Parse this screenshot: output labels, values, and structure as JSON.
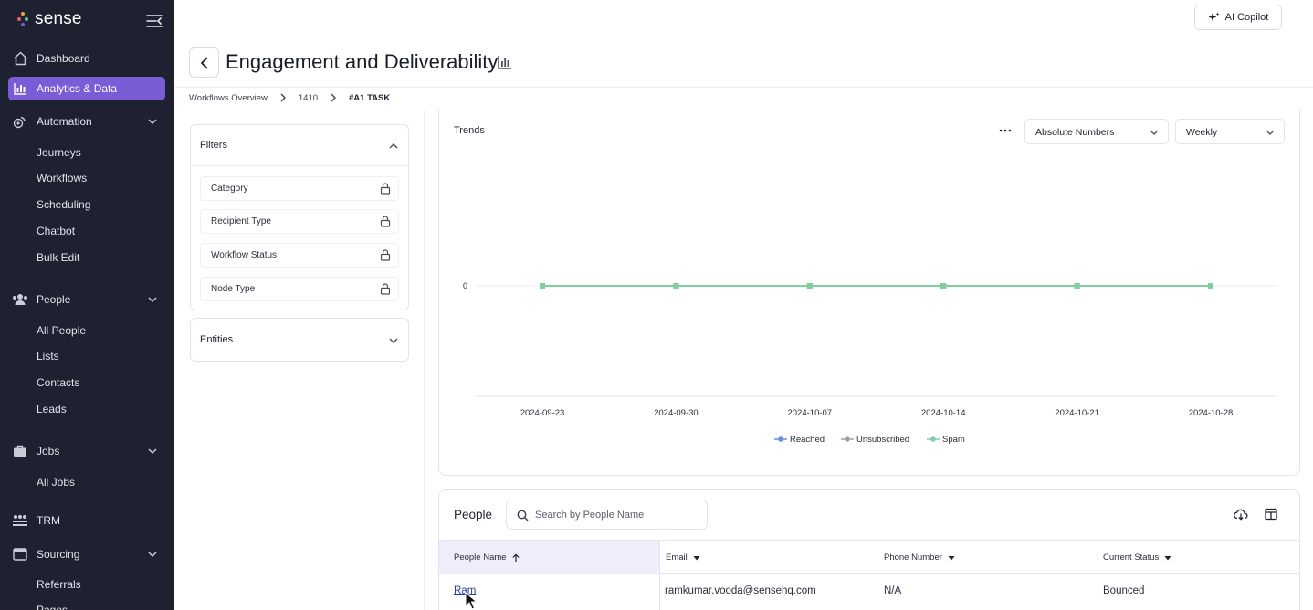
{
  "brand": {
    "name": "sense"
  },
  "sidebar": {
    "items": [
      {
        "label": "Dashboard",
        "icon": "home-icon"
      },
      {
        "label": "Analytics & Data",
        "icon": "bar-chart-icon",
        "active": true
      },
      {
        "label": "Automation",
        "icon": "automation-icon",
        "expandable": true
      },
      {
        "label": "People",
        "icon": "people-icon",
        "expandable": true
      },
      {
        "label": "Jobs",
        "icon": "briefcase-icon",
        "expandable": true
      },
      {
        "label": "TRM",
        "icon": "trm-icon"
      },
      {
        "label": "Sourcing",
        "icon": "sourcing-icon",
        "expandable": true
      }
    ],
    "automation_sub": [
      "Journeys",
      "Workflows",
      "Scheduling",
      "Chatbot",
      "Bulk Edit"
    ],
    "people_sub": [
      "All People",
      "Lists",
      "Contacts",
      "Leads"
    ],
    "jobs_sub": [
      "All Jobs"
    ],
    "sourcing_sub": [
      "Referrals",
      "Pages"
    ]
  },
  "header": {
    "copilot_label": "AI Copilot",
    "title": "Engagement and Deliverability",
    "breadcrumb": [
      "Workflows Overview",
      "1410",
      "#A1 TASK"
    ]
  },
  "filters": {
    "title": "Filters",
    "rows": [
      "Category",
      "Recipient Type",
      "Workflow Status",
      "Node Type"
    ],
    "entities_title": "Entities"
  },
  "trends": {
    "title": "Trends",
    "mode_select": "Absolute Numbers",
    "period_select": "Weekly"
  },
  "chart_data": {
    "type": "line",
    "title": "Trends",
    "x": [
      "2024-09-23",
      "2024-09-30",
      "2024-10-07",
      "2024-10-14",
      "2024-10-21",
      "2024-10-28"
    ],
    "yticks": [
      "0"
    ],
    "series": [
      {
        "name": "Reached",
        "color": "#6b8fd6",
        "values": [
          0,
          0,
          0,
          0,
          0,
          0
        ]
      },
      {
        "name": "Unsubscribed",
        "color": "#9aa0b8",
        "values": [
          0,
          0,
          0,
          0,
          0,
          0
        ]
      },
      {
        "name": "Spam",
        "color": "#7fcf9f",
        "values": [
          0,
          0,
          0,
          0,
          0,
          0
        ]
      }
    ],
    "legend": "bottom-center",
    "grid": false
  },
  "people": {
    "title": "People",
    "search_placeholder": "Search by People Name",
    "columns": [
      "People Name",
      "Email",
      "Phone Number",
      "Current Status"
    ],
    "rows": [
      {
        "name": "Ram",
        "email": "ramkumar.vooda@sensehq.com",
        "phone": "N/A",
        "status": "Bounced"
      }
    ]
  },
  "colors": {
    "sidebar_bg": "#1e2130",
    "accent": "#7a5cd6",
    "line": "#7fcf9f",
    "link": "#2b3f9e"
  }
}
